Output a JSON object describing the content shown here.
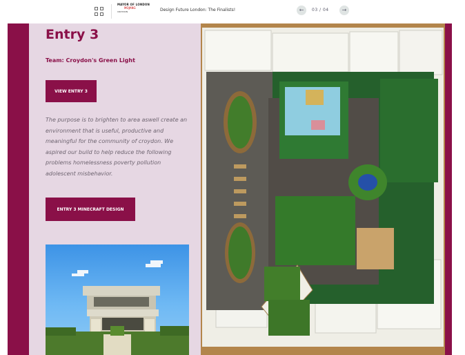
{
  "topbar": {
    "logo_line1": "MAYOR OF LONDON",
    "logo_line2": "MOJANG",
    "logo_line3": "CROYDON",
    "doc_title": "Design Future London: The Finalists!",
    "pager": "03 / 04",
    "icons": [
      "grid-icon",
      "arrow-left-icon",
      "arrow-right-icon"
    ]
  },
  "entry": {
    "title": "Entry 3",
    "team": "Team: Croydon's Green Light",
    "view_button": "VIEW ENTRY 3",
    "description": "The purpose is to brighten to area aswell create an environment that is useful, productive and meaningful for the community of croydon. We aspired our build to help reduce the following problems homelessness poverty pollution adolescent misbehavior.",
    "minecraft_button": "ENTRY 3 MINECRAFT DESIGN"
  },
  "colors": {
    "brand": "#8a1048",
    "panel": "#e6d7e3",
    "text": "#6e6470"
  }
}
